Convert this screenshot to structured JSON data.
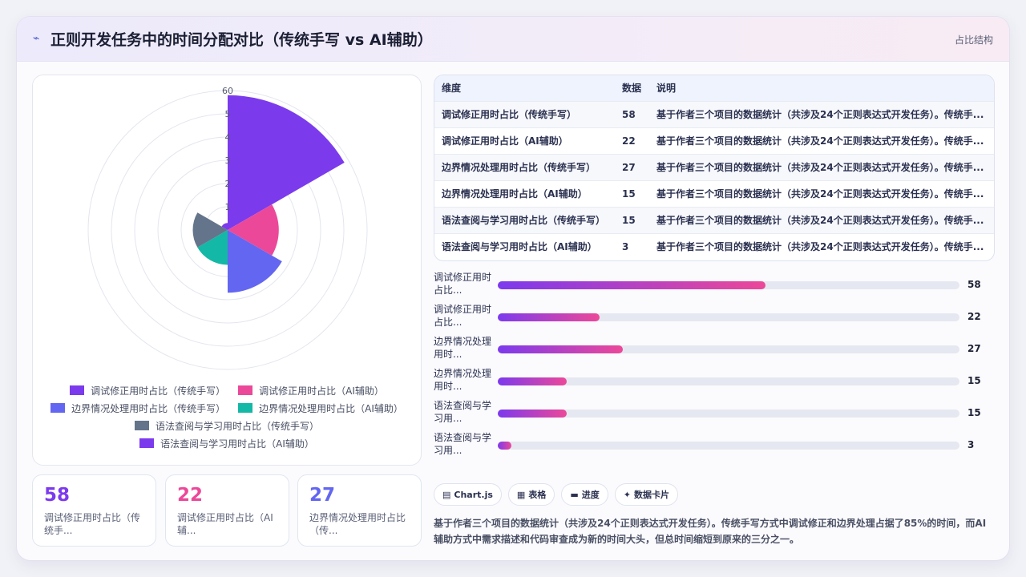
{
  "header": {
    "icon": "chart-icon",
    "title": "正则开发任务中的时间分配对比（传统手写 vs AI辅助）",
    "tag": "占比结构"
  },
  "chart_data": {
    "type": "polarArea",
    "categories": [
      "调试修正用时占比（传统手写）",
      "调试修正用时占比（AI辅助）",
      "边界情况处理用时占比（传统手写）",
      "边界情况处理用时占比（AI辅助）",
      "语法查阅与学习用时占比（传统手写）",
      "语法查阅与学习用时占比（AI辅助）"
    ],
    "values": [
      58,
      22,
      27,
      15,
      15,
      3
    ],
    "colors": [
      "#7c3aed",
      "#ec4899",
      "#6366f1",
      "#14b8a6",
      "#64748b",
      "#7c3aed"
    ],
    "rlim": [
      0,
      60
    ],
    "r_ticks": [
      10,
      20,
      30,
      40,
      50,
      60
    ],
    "tick_labels": [
      "1",
      "2",
      "3",
      "4",
      "5",
      "60"
    ],
    "legend_position": "bottom"
  },
  "kpis": [
    {
      "value": "58",
      "label": "调试修正用时占比（传统手...",
      "color": "#7c3aed"
    },
    {
      "value": "22",
      "label": "调试修正用时占比（AI辅...",
      "color": "#ec4899"
    },
    {
      "value": "27",
      "label": "边界情况处理用时占比（传...",
      "color": "#6366f1"
    }
  ],
  "table": {
    "headers": [
      "维度",
      "数据",
      "说明"
    ],
    "rows": [
      {
        "dim": "调试修正用时占比（传统手写）",
        "num": "58",
        "desc": "基于作者三个项目的数据统计（共涉及24个正则表达式开发任务）。传统手..."
      },
      {
        "dim": "调试修正用时占比（AI辅助）",
        "num": "22",
        "desc": "基于作者三个项目的数据统计（共涉及24个正则表达式开发任务）。传统手..."
      },
      {
        "dim": "边界情况处理用时占比（传统手写）",
        "num": "27",
        "desc": "基于作者三个项目的数据统计（共涉及24个正则表达式开发任务）。传统手..."
      },
      {
        "dim": "边界情况处理用时占比（AI辅助）",
        "num": "15",
        "desc": "基于作者三个项目的数据统计（共涉及24个正则表达式开发任务）。传统手..."
      },
      {
        "dim": "语法查阅与学习用时占比（传统手写）",
        "num": "15",
        "desc": "基于作者三个项目的数据统计（共涉及24个正则表达式开发任务）。传统手..."
      },
      {
        "dim": "语法查阅与学习用时占比（AI辅助）",
        "num": "3",
        "desc": "基于作者三个项目的数据统计（共涉及24个正则表达式开发任务）。传统手..."
      }
    ]
  },
  "progress": {
    "max": 100,
    "items": [
      {
        "label": "调试修正用时占比...",
        "value": 58
      },
      {
        "label": "调试修正用时占比...",
        "value": 22
      },
      {
        "label": "边界情况处理用时...",
        "value": 27
      },
      {
        "label": "边界情况处理用时...",
        "value": 15
      },
      {
        "label": "语法查阅与学习用...",
        "value": 15
      },
      {
        "label": "语法查阅与学习用...",
        "value": 3
      }
    ]
  },
  "chips": [
    {
      "icon": "chart-icon",
      "glyph": "▤",
      "label": "Chart.js"
    },
    {
      "icon": "table-icon",
      "glyph": "▦",
      "label": "表格"
    },
    {
      "icon": "progress-icon",
      "glyph": "▬",
      "label": "进度"
    },
    {
      "icon": "sparkle-icon",
      "glyph": "✦",
      "label": "数据卡片"
    }
  ],
  "summary": "基于作者三个项目的数据统计（共涉及24个正则表达式开发任务）。传统手写方式中调试修正和边界处理占据了85%的时间，而AI辅助方式中需求描述和代码审查成为新的时间大头，但总时间缩短到原来的三分之一。"
}
